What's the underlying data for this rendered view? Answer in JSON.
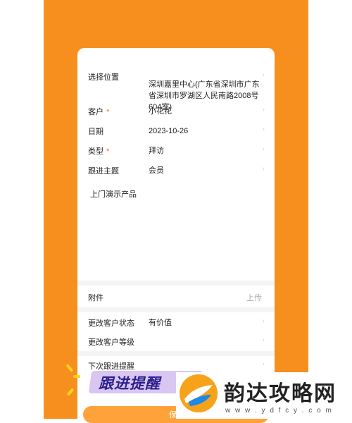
{
  "form": {
    "location_label": "选择位置",
    "location_value": "深圳嘉里中心(广东省深圳市广东省深圳市罗湖区人民南路2008号604室)",
    "customer_label": "客户",
    "customer_value": "小花花",
    "date_label": "日期",
    "date_value": "2023-10-26",
    "type_label": "类型",
    "type_value": "拜访",
    "topic_label": "跟进主题",
    "topic_value": "会员",
    "content_text": "上门演示产品",
    "attachment_label": "附件",
    "upload_label": "上传",
    "status_label": "更改客户状态",
    "status_value": "有价值",
    "level_label": "更改客户等级",
    "reminder_label": "下次跟进提醒",
    "required_mark": "*",
    "chevron": "›"
  },
  "banner": {
    "text": "跟进提醒"
  },
  "save_button": {
    "label": "保"
  },
  "watermark": {
    "title": "韵达攻略网",
    "url": "w w w . y d f c y . c o m"
  },
  "colors": {
    "accent": "#f78f1e",
    "required": "#f5642c",
    "banner_text": "#2b1f8f"
  }
}
